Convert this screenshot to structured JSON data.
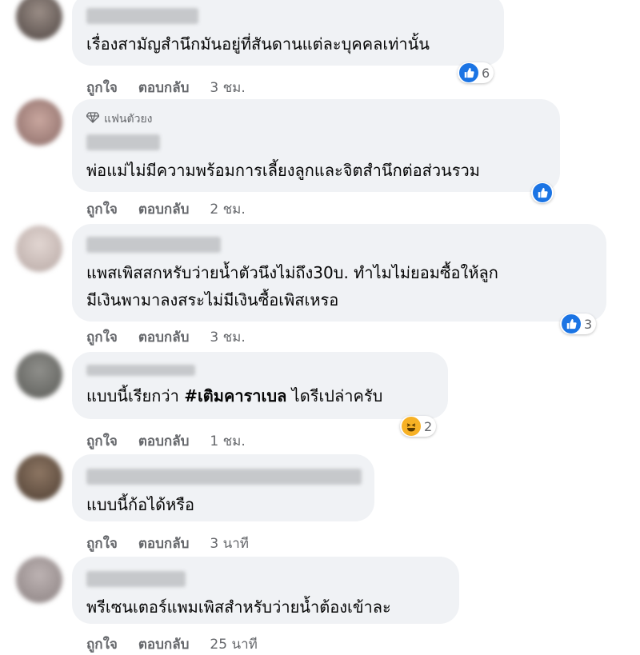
{
  "comments": [
    {
      "author_blurred": true,
      "text": "เรื่องสามัญสำนึกมันอยู่ที่สันดานแต่ละบุคคลเท่านั้น",
      "like_label": "ถูกใจ",
      "reply_label": "ตอบกลับ",
      "time": "3 ชม.",
      "reaction": {
        "icon": "like-icon",
        "count": "6"
      }
    },
    {
      "author_blurred": true,
      "badge": "แฟนตัวยง",
      "badge_icon": "diamond-icon",
      "text": "พ่อแม่ไม่มีความพร้อมการเลี้ยงลูกและจิตสำนึกต่อส่วนรวม",
      "like_label": "ถูกใจ",
      "reply_label": "ตอบกลับ",
      "time": "2 ชม.",
      "reaction": {
        "icon": "like-icon",
        "count": ""
      }
    },
    {
      "author_blurred": true,
      "text_line1": "แพสเพิสสกหรับว่ายน้ำตัวนึงไม่ถึง30บ. ทำไมไม่ยอมซื้อให้ลูก",
      "text_line2": "มีเงินพามาลงสระไม่มีเงินซื้อเพิสเหรอ",
      "like_label": "ถูกใจ",
      "reply_label": "ตอบกลับ",
      "time": "3 ชม.",
      "reaction": {
        "icon": "like-icon",
        "count": "3"
      }
    },
    {
      "author_blurred": true,
      "text_before": "แบบนี้เรียกว่า ",
      "hashtag": "#เติมคาราเบล",
      "text_after": " ไดรีเปล่าครับ",
      "like_label": "ถูกใจ",
      "reply_label": "ตอบกลับ",
      "time": "1 ชม.",
      "reaction": {
        "icon": "haha-icon",
        "count": "2"
      }
    },
    {
      "author_blurred": true,
      "text": "แบบนี้ก้อได้หรือ",
      "like_label": "ถูกใจ",
      "reply_label": "ตอบกลับ",
      "time": "3 นาที"
    },
    {
      "author_blurred": true,
      "text": "พรีเซนเตอร์แพมเพิสสำหรับว่ายน้ำต้องเข้าละ",
      "like_label": "ถูกใจ",
      "reply_label": "ตอบกลับ",
      "time": "25 นาที"
    }
  ],
  "colors": {
    "bubble": "#f0f2f5",
    "secondary_text": "#65676b",
    "like_blue": "#1b74e4",
    "haha_yellow": "#f7b125"
  }
}
